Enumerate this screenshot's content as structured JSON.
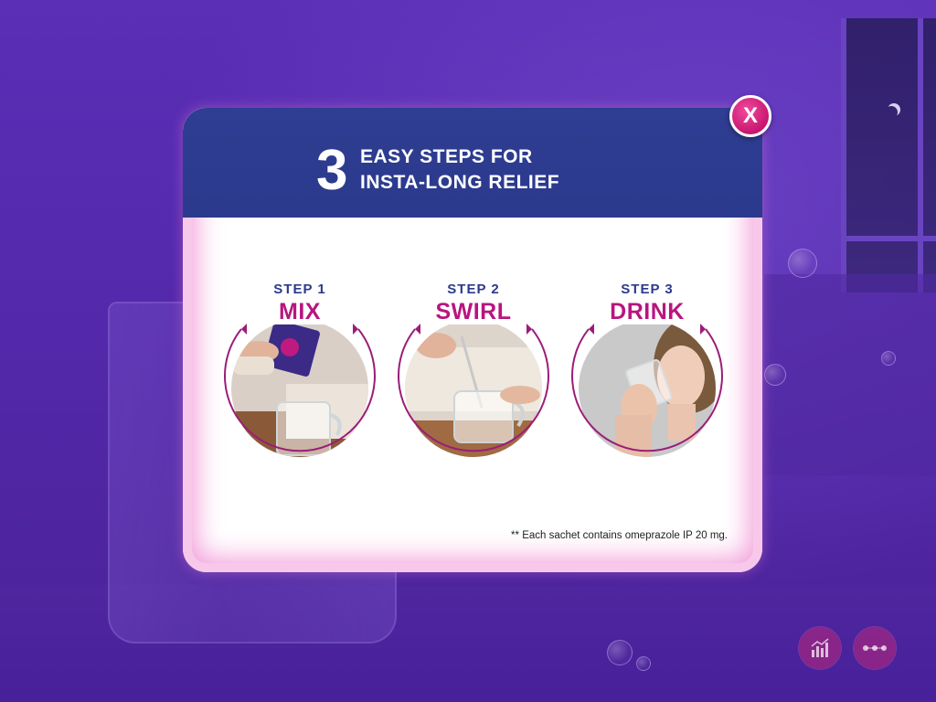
{
  "modal": {
    "header": {
      "number": "3",
      "line1": "EASY STEPS FOR",
      "line2": "INSTA-LONG RELIEF"
    },
    "steps": [
      {
        "label": "STEP 1",
        "action": "MIX",
        "icon": "sachet-pour-photo"
      },
      {
        "label": "STEP 2",
        "action": "SWIRL",
        "icon": "spoon-stir-photo"
      },
      {
        "label": "STEP 3",
        "action": "DRINK",
        "icon": "woman-drinking-photo"
      }
    ],
    "footnote": "** Each sachet contains omeprazole IP 20 mg.",
    "close_label": "X"
  },
  "nav": {
    "chart_icon": "bar-chart-icon",
    "more_icon": "more-dots-icon"
  },
  "colors": {
    "header_bg": "#2f3d92",
    "accent_magenta": "#b8157f",
    "step_label": "#2c3a8c",
    "background": "#5a2db0"
  }
}
